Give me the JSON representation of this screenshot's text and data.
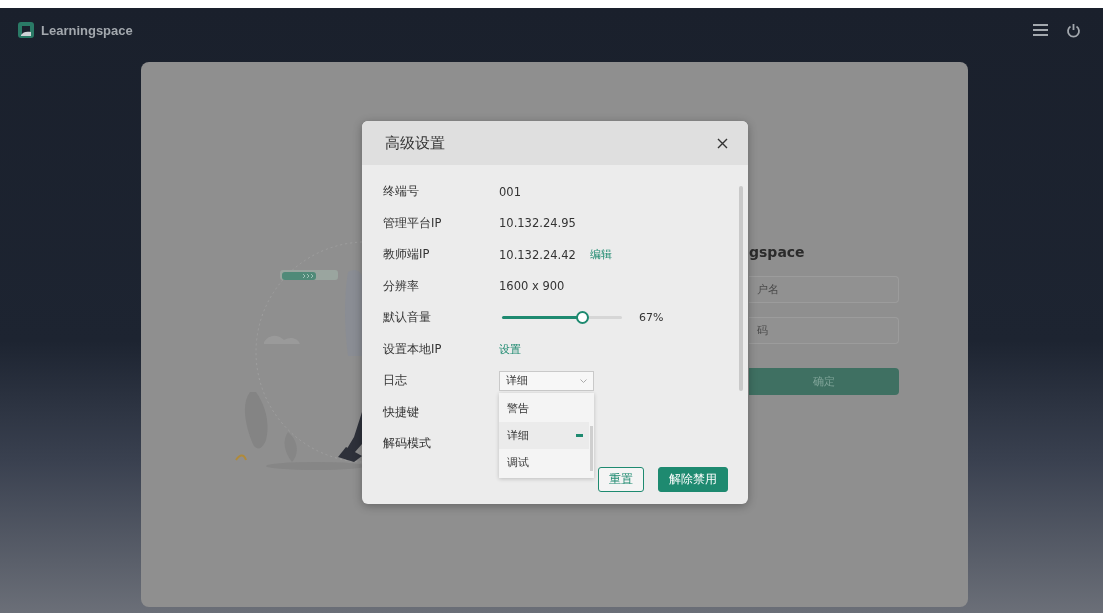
{
  "topbar": {
    "logo_text": "Learningspace"
  },
  "login": {
    "title": "gspace",
    "username_placeholder": "户名",
    "password_placeholder": "码",
    "submit": "确定"
  },
  "dialog": {
    "title": "高级设置",
    "rows": [
      {
        "kind": "text",
        "label": "终端号",
        "value": "001"
      },
      {
        "kind": "text",
        "label": "管理平台IP",
        "value": "10.132.24.95"
      },
      {
        "kind": "text-link",
        "label": "教师端IP",
        "value": "10.132.24.42",
        "link": "编辑"
      },
      {
        "kind": "text",
        "label": "分辨率",
        "value": "1600 x 900"
      },
      {
        "kind": "slider",
        "label": "默认音量",
        "level": 0.67,
        "reading": "67%"
      },
      {
        "kind": "link",
        "label": "设置本地IP",
        "link": "设置"
      },
      {
        "kind": "select",
        "label": "日志",
        "value": "详细",
        "expanded": true,
        "options": [
          {
            "label": "警告",
            "selected": false
          },
          {
            "label": "详细",
            "selected": true
          },
          {
            "label": "调试",
            "selected": false
          }
        ]
      },
      {
        "kind": "empty",
        "label": "快捷键"
      },
      {
        "kind": "empty",
        "label": "解码模式"
      }
    ],
    "buttons": [
      {
        "kind": "outline",
        "label": "重置"
      },
      {
        "kind": "primary",
        "label": "解除禁用"
      }
    ]
  }
}
